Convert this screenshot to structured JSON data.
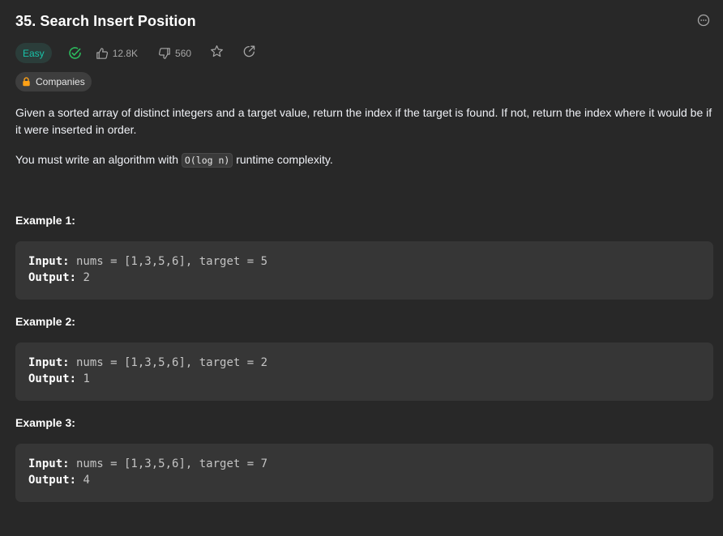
{
  "problem": {
    "title": "35. Search Insert Position",
    "difficulty": "Easy",
    "likes": "12.8K",
    "dislikes": "560",
    "companies_label": "Companies"
  },
  "description": {
    "para1": "Given a sorted array of distinct integers and a target value, return the index if the target is found. If not, return the index where it would be if it were inserted in order.",
    "para2_before": "You must write an algorithm with ",
    "para2_code": "O(log n)",
    "para2_after": " runtime complexity."
  },
  "examples": [
    {
      "title": "Example 1:",
      "input_label": "Input:",
      "input": " nums = [1,3,5,6], target = 5",
      "output_label": "Output:",
      "output": " 2"
    },
    {
      "title": "Example 2:",
      "input_label": "Input:",
      "input": " nums = [1,3,5,6], target = 2",
      "output_label": "Output:",
      "output": " 1"
    },
    {
      "title": "Example 3:",
      "input_label": "Input:",
      "input": " nums = [1,3,5,6], target = 7",
      "output_label": "Output:",
      "output": " 4"
    }
  ],
  "icons": {
    "more": "more-options-icon",
    "solved": "check-circle-icon",
    "like": "thumbs-up-icon",
    "dislike": "thumbs-down-icon",
    "star": "star-icon",
    "share": "share-icon",
    "lock": "lock-icon"
  },
  "colors": {
    "background": "#282828",
    "easy": "#19c2a8",
    "solved": "#2cbb5d",
    "lock": "#ffa116",
    "code_block": "#363636"
  }
}
